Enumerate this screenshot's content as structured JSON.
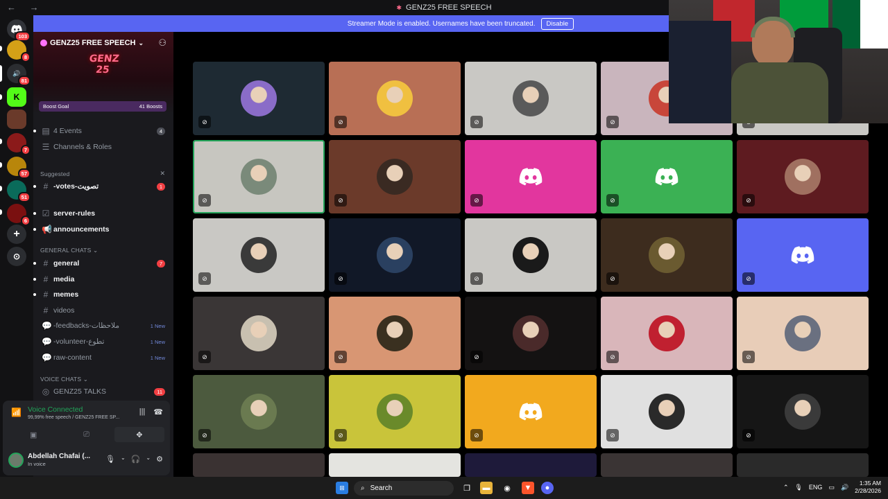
{
  "window": {
    "title": "GENZ25 FREE SPEECH",
    "nav_arrows": "← →"
  },
  "banner": {
    "text": "Streamer Mode is enabled. Usernames have been truncated.",
    "button": "Disable"
  },
  "rail": {
    "servers": [
      {
        "badge": "103",
        "color": "#313338"
      },
      {
        "badge": "8",
        "color": "#d4a017"
      },
      {
        "badge": "81",
        "color": "#2b2d31"
      },
      {
        "badge": "",
        "color": "#53fc18"
      },
      {
        "badge": "",
        "color": "#6a3a2a"
      },
      {
        "badge": "7",
        "color": "#8b1a1a"
      },
      {
        "badge": "57",
        "color": "#b8860b"
      },
      {
        "badge": "51",
        "color": "#0a6b5a"
      },
      {
        "badge": "6",
        "color": "#7a1010"
      }
    ]
  },
  "sidebar": {
    "server_name": "GENZ25 FREE SPEECH",
    "banner_text": "GENZ 25",
    "boost": {
      "label": "Boost Goal",
      "count": "41 Boosts"
    },
    "events": {
      "label": "4 Events",
      "count": "4"
    },
    "channels_roles": "Channels & Roles",
    "suggested": "Suggested",
    "votes": {
      "label": "-votes-تصويت",
      "count": "1"
    },
    "server_rules": "server-rules",
    "announcements": "announcements",
    "general_chats": "GENERAL CHATS",
    "general": {
      "label": "general",
      "count": "7"
    },
    "media": "media",
    "memes": "memes",
    "videos": "videos",
    "feedbacks": {
      "label": "-feedbacks-ملاحظات",
      "new": "1 New"
    },
    "volunteer": {
      "label": "-volunteer-تطوع",
      "new": "1 New"
    },
    "raw_content": {
      "label": "raw-content",
      "new": "1 New"
    },
    "voice_chats": "VOICE CHATS",
    "talks": {
      "label": "GENZ25 TALKS",
      "count": "11"
    }
  },
  "voice": {
    "status": "Voice Connected",
    "sub": "99,99% free speech / GENZ25 FREE SP..."
  },
  "user": {
    "name": "Abdellah Chafai (...",
    "status": "In voice"
  },
  "grid": {
    "tiles": [
      {
        "bg": "#1e2a33",
        "av": "#8a6cc8"
      },
      {
        "bg": "#b86f55",
        "av": "#f0c040"
      },
      {
        "bg": "#c9c8c4",
        "av": "#5a5a5a"
      },
      {
        "bg": "#c9b5bd",
        "av": "#c8463a"
      },
      {
        "bg": "#c9c8c4",
        "av": "#4a6a7a"
      },
      {
        "bg": "#c7c6c0",
        "av": "#7a8a7a",
        "selected": true
      },
      {
        "bg": "#6b3a2a",
        "av": "#3a2a22"
      },
      {
        "bg": "#e2369e",
        "discord": true
      },
      {
        "bg": "#3bb154",
        "discord": true
      },
      {
        "bg": "#5e1b20",
        "av": "#a07060"
      },
      {
        "bg": "#c9c8c4",
        "av": "#3a3a3a"
      },
      {
        "bg": "#111827",
        "av": "#2a4060"
      },
      {
        "bg": "#c9c8c4",
        "av": "#1a1a1a"
      },
      {
        "bg": "#3d2c1e",
        "av": "#6a5a30"
      },
      {
        "bg": "#5865f2",
        "discord": true
      },
      {
        "bg": "#3a3636",
        "av": "#c8c0b0"
      },
      {
        "bg": "#d89673",
        "av": "#3a3020"
      },
      {
        "bg": "#141212",
        "av": "#4a2a2a"
      },
      {
        "bg": "#d9b6ba",
        "av": "#c02030"
      },
      {
        "bg": "#e8cdb8",
        "av": "#6a7080"
      },
      {
        "bg": "#4c5a3e",
        "av": "#6a7a50"
      },
      {
        "bg": "#c9c43a",
        "av": "#6a8a2a"
      },
      {
        "bg": "#f2a91e",
        "discord": true
      },
      {
        "bg": "#e0e0e0",
        "av": "#2a2a2a"
      },
      {
        "bg": "#161616",
        "av": "#3a3a3a"
      }
    ]
  },
  "taskbar": {
    "search": "Search",
    "lang": "ENG",
    "time": "1:35 AM",
    "date": "2/28/2026"
  }
}
